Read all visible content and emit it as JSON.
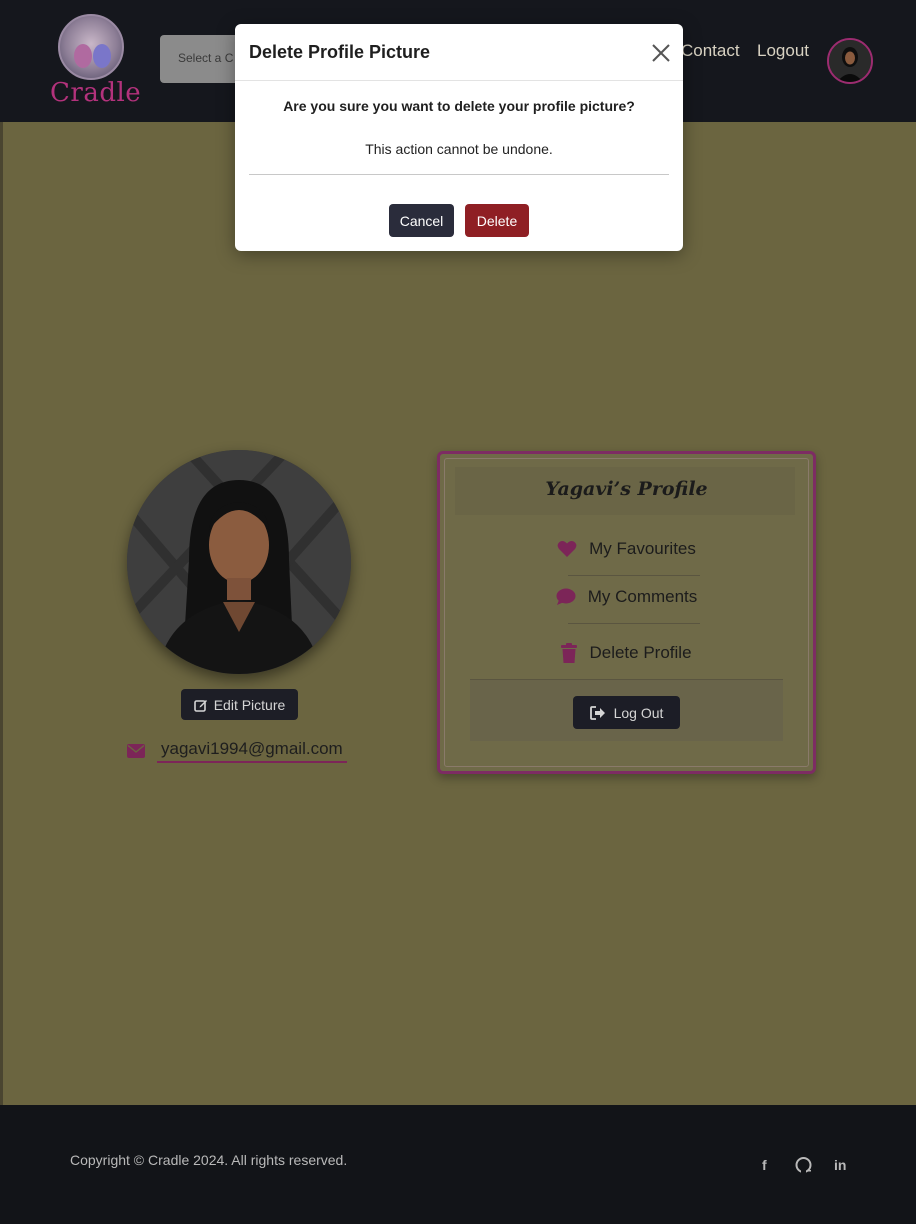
{
  "header": {
    "logo_text": "Cradle",
    "select_placeholder": "Select a C",
    "nav": {
      "contact": "Contact",
      "logout": "Logout"
    }
  },
  "profile": {
    "edit_picture_label": "Edit Picture",
    "email": "yagavi1994@gmail.com"
  },
  "card": {
    "title": "Yagavi’s Profile",
    "items": [
      {
        "label": "My Favourites",
        "icon": "heart-icon"
      },
      {
        "label": "My Comments",
        "icon": "comment-icon"
      },
      {
        "label": "Delete Profile",
        "icon": "trash-icon"
      }
    ],
    "logout_label": "Log Out"
  },
  "footer": {
    "copyright": "Copyright © Cradle 2024. All rights reserved.",
    "social": [
      "f",
      "github-icon",
      "in"
    ]
  },
  "modal": {
    "title": "Delete Profile Picture",
    "question": "Are you sure you want to delete your profile picture?",
    "note": "This action cannot be undone.",
    "cancel_label": "Cancel",
    "delete_label": "Delete"
  },
  "colors": {
    "overlay_bg": "#6b6540",
    "accent": "#b3327c",
    "danger": "#8f1f24",
    "dark_button": "#1d1e26"
  }
}
